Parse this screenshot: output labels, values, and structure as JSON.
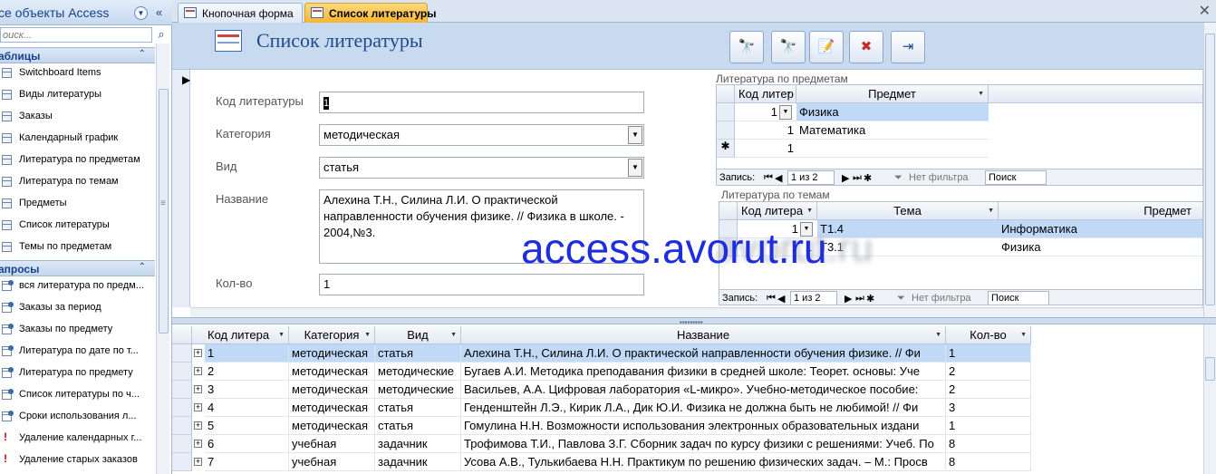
{
  "nav": {
    "title": "се объекты Access",
    "search_placeholder": "оиск...",
    "groups": [
      {
        "label": "аблицы",
        "items": [
          "Switchboard Items",
          "Виды литературы",
          "Заказы",
          "Календарный график",
          "Литература по предметам",
          "Литература по темам",
          "Предметы",
          "Список литературы",
          "Темы по предметам"
        ]
      },
      {
        "label": "апросы",
        "items": [
          "вся литература по предм...",
          "Заказы за период",
          "Заказы по предмету",
          "Литература по дате по т...",
          "Литература по предмету",
          "Список литературы по ч...",
          "Сроки использования л...",
          "Удаление календарных г...",
          "Удаление старых заказов"
        ]
      }
    ]
  },
  "tabs": [
    {
      "label": "Кнопочная форма",
      "active": false
    },
    {
      "label": "Список литературы",
      "active": true
    }
  ],
  "form": {
    "title": "Список литературы",
    "toolbar_icons": [
      "find-icon",
      "find-next-icon",
      "new-record-icon",
      "delete-record-icon",
      "exit-icon"
    ],
    "toolbar_glyphs": [
      "🔭",
      "🔭",
      "📝",
      "✖",
      "⇥"
    ],
    "fields": {
      "code_label": "Код литературы",
      "code_value": "1",
      "category_label": "Категория",
      "category_value": "методическая",
      "kind_label": "Вид",
      "kind_value": "статья",
      "name_label": "Название",
      "name_value": "Алехина Т.Н., Силина Л.И. О практической направленности обучения физике. // Физика в школе. - 2004,№3.",
      "qty_label": "Кол-во",
      "qty_value": "1"
    },
    "sub1": {
      "caption": "Литература по предметам",
      "headers": [
        "Код литер",
        "Предмет"
      ],
      "rows": [
        {
          "code": "1",
          "subject": "Физика"
        },
        {
          "code": "1",
          "subject": "Математика"
        },
        {
          "code": "1",
          "subject": ""
        }
      ],
      "new_row_marker": "✱",
      "nav": {
        "label": "Запись:",
        "position": "1 из 2",
        "filter": "Нет фильтра",
        "search": "Поиск"
      }
    },
    "sub2": {
      "caption": "Литература по темам",
      "headers": [
        "Код литера",
        "Тема",
        "Предмет"
      ],
      "rows": [
        {
          "code": "1",
          "topic": "Т1.4",
          "subject": "Информатика"
        },
        {
          "code": "1",
          "topic": "Т3.1",
          "subject": "Физика"
        }
      ],
      "nav": {
        "label": "Запись:",
        "position": "1 из 2",
        "filter": "Нет фильтра",
        "search": "Поиск"
      }
    }
  },
  "watermark": "access.avorut.ru",
  "watermark_ghost": "avorut.ru",
  "datasheet": {
    "headers": [
      "Код литера",
      "Категория",
      "Вид",
      "Название",
      "Кол-во"
    ],
    "rows": [
      {
        "code": "1",
        "category": "методическая",
        "kind": "статья",
        "name": "Алехина Т.Н., Силина Л.И. О практической направленности обучения физике. // Фи",
        "qty": "1"
      },
      {
        "code": "2",
        "category": "методическая",
        "kind": "методические",
        "name": "Бугаев А.И. Методика преподавания физики в средней школе: Теорет. основы: Уче",
        "qty": "2"
      },
      {
        "code": "3",
        "category": "методическая",
        "kind": "методические",
        "name": "Васильев, А.А. Цифровая лаборатория «L-микро». Учебно-методическое пособие:",
        "qty": "2"
      },
      {
        "code": "4",
        "category": "методическая",
        "kind": "статья",
        "name": "Генденштейн Л.Э., Кирик Л.А., Дик Ю.И. Физика не должна быть не любимой! // Фи",
        "qty": "3"
      },
      {
        "code": "5",
        "category": "методическая",
        "kind": "статья",
        "name": "Гомулина Н.Н. Возможности использования электронных образовательных издани",
        "qty": "1"
      },
      {
        "code": "6",
        "category": "учебная",
        "kind": "задачник",
        "name": "Трофимова Т.И., Павлова З.Г. Сборник задач по курсу физики с решениями: Учеб. По",
        "qty": "8"
      },
      {
        "code": "7",
        "category": "учебная",
        "kind": "задачник",
        "name": "Усова А.В., Тулькибаева Н.Н. Практикум по решению физических задач. – М.: Просв",
        "qty": "8"
      }
    ]
  }
}
